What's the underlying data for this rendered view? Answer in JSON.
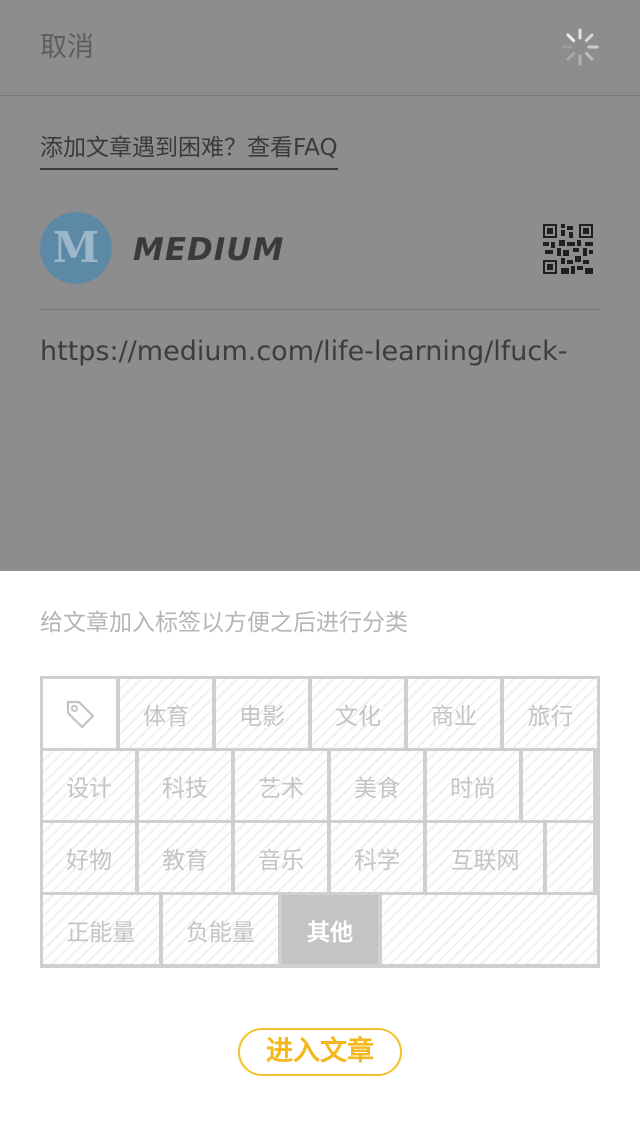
{
  "nav": {
    "cancel_label": "取消"
  },
  "faq": {
    "link_text": "添加文章遇到困难？查看FAQ"
  },
  "source": {
    "logo_letter": "M",
    "name": "MEDIUM"
  },
  "article": {
    "url": "https://medium.com/life-learning/lfuck-"
  },
  "tags": {
    "hint": "给文章加入标签以方便之后进行分类",
    "row1": [
      "体育",
      "电影",
      "文化",
      "商业",
      "旅行"
    ],
    "row2": [
      "设计",
      "科技",
      "艺术",
      "美食",
      "时尚"
    ],
    "row3": [
      "好物",
      "教育",
      "音乐",
      "科学",
      "互联网"
    ],
    "row4": [
      "正能量",
      "负能量",
      "其他"
    ],
    "selected": "其他"
  },
  "actions": {
    "enter_article_label": "进入文章"
  },
  "colors": {
    "accent": "#f5c133",
    "overlay": "#8d8d8d",
    "selected_tag": "#c4c4c4"
  },
  "icons": [
    "loading-spinner-icon",
    "medium-logo",
    "qr-code-icon",
    "tag-icon"
  ]
}
